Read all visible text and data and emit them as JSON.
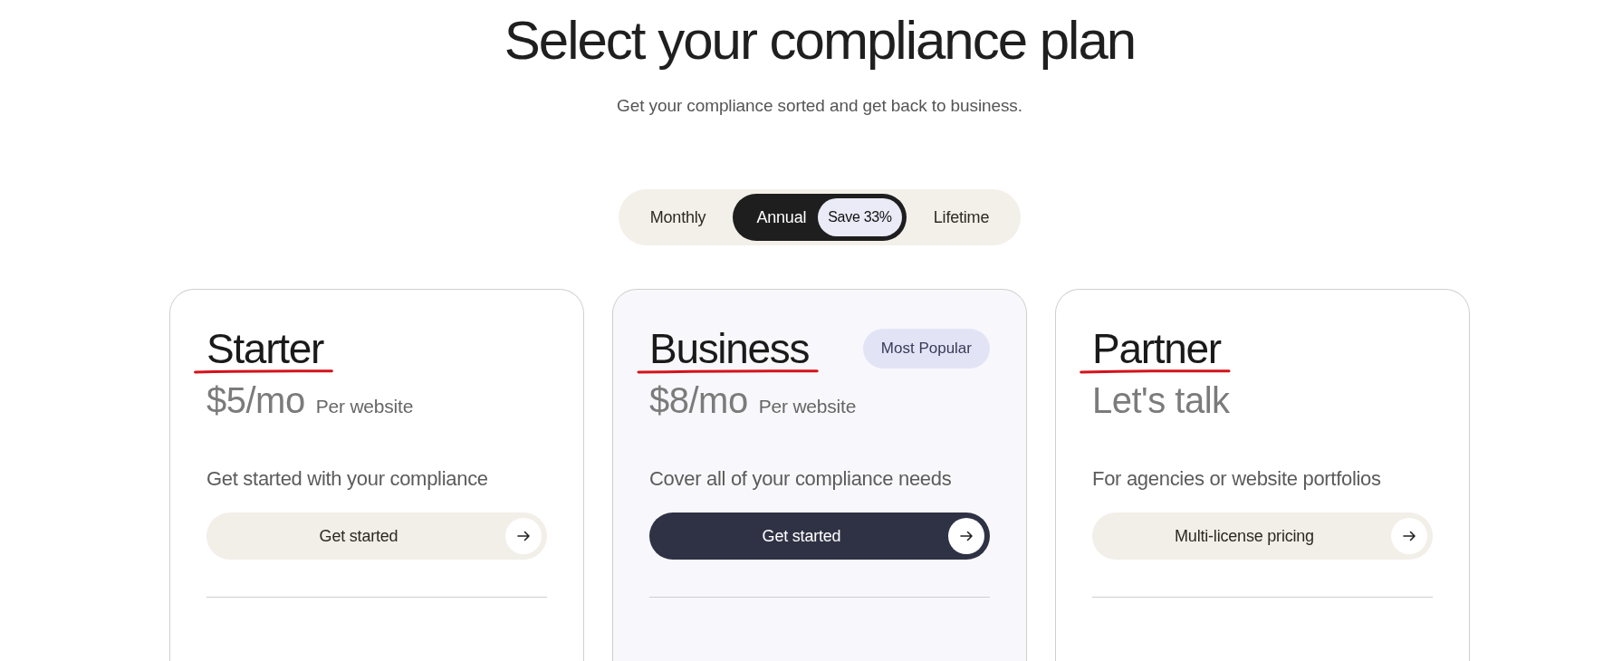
{
  "header": {
    "title": "Select your compliance plan",
    "subtitle": "Get your compliance sorted and get back to business."
  },
  "billing_toggle": {
    "options": [
      {
        "label": "Monthly",
        "selected": false
      },
      {
        "label": "Annual",
        "selected": true,
        "badge": "Save 33%"
      },
      {
        "label": "Lifetime",
        "selected": false
      }
    ]
  },
  "plans": [
    {
      "name": "Starter",
      "underlined": true,
      "featured": false,
      "price": "$5/mo",
      "price_note": "Per website",
      "description": "Get started with your compliance",
      "button": "Get started"
    },
    {
      "name": "Business",
      "underlined": true,
      "featured": true,
      "badge": "Most Popular",
      "price": "$8/mo",
      "price_note": "Per website",
      "description": "Cover all of your compliance needs",
      "button": "Get started"
    },
    {
      "name": "Partner",
      "underlined": true,
      "featured": false,
      "price": "Let's talk",
      "description": "For agencies or website portfolios",
      "button": "Multi-license pricing"
    }
  ]
}
